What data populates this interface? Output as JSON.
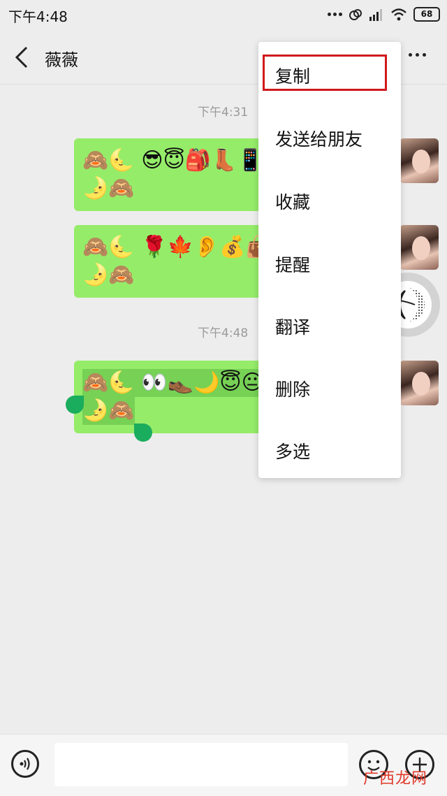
{
  "status_bar": {
    "time": "下午4:48",
    "battery": "68"
  },
  "header": {
    "title": "薇薇"
  },
  "messages": [
    {
      "timestamp": "下午4:31"
    },
    {
      "lines": [
        "🙈🌜 😎😇🎒👢📱▪️",
        "🌛🙈"
      ]
    },
    {
      "lines": [
        "🙈🌜 🌹🍁👂💰👜",
        "🌛🙈"
      ]
    },
    {
      "timestamp": "下午4:48"
    },
    {
      "lines": [
        "🙈🌜 👀👞🌙😇😐◀️",
        "🌛🙈"
      ],
      "selected": true
    }
  ],
  "context_menu": {
    "items": [
      "复制",
      "发送给朋友",
      "收藏",
      "提醒",
      "翻译",
      "删除",
      "多选"
    ],
    "highlighted": "复制",
    "highlight_color": "#d0191b"
  },
  "colors": {
    "bubble": "#95ec69",
    "background": "#ededed",
    "handle": "#1aad5e"
  },
  "icons": [
    "back-arrow-icon",
    "more-icon",
    "voice-icon",
    "emoji-icon",
    "plus-icon"
  ],
  "watermark": "广西龙网"
}
